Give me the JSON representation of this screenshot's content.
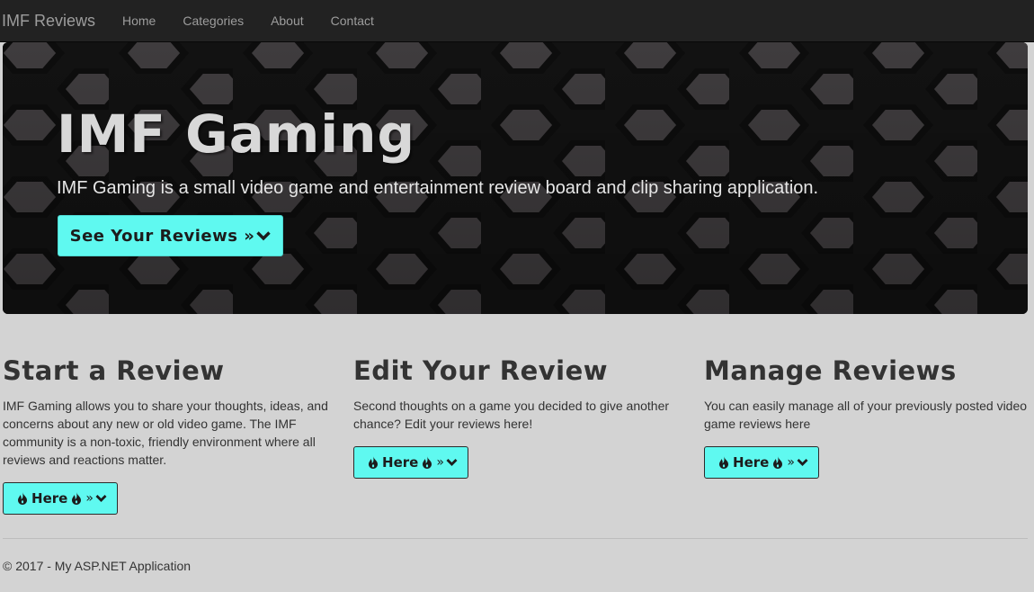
{
  "navbar": {
    "brand": "IMF Reviews",
    "items": [
      "Home",
      "Categories",
      "About",
      "Contact"
    ]
  },
  "hero": {
    "title": "IMF Gaming",
    "lead": "IMF Gaming is a small video game and entertainment review board and clip sharing application.",
    "button_label": "See Your Reviews »"
  },
  "columns": [
    {
      "heading": "Start a Review",
      "text": "IMF Gaming allows you to share your thoughts, ideas, and concerns about any new or old video game. The IMF community is a non-toxic, friendly environment where all reviews and reactions matter.",
      "button_label": "Here",
      "button_suffix": "»"
    },
    {
      "heading": "Edit Your Review",
      "text": "Second thoughts on a game you decided to give another chance? Edit your reviews here!",
      "button_label": "Here",
      "button_suffix": "»"
    },
    {
      "heading": "Manage Reviews",
      "text": "You can easily manage all of your previously posted video game reviews here",
      "button_label": "Here",
      "button_suffix": "»"
    }
  ],
  "footer": {
    "text": "© 2017 - My ASP.NET Application"
  },
  "icons": {
    "hero_button": "chevron-down-icon",
    "small_button": [
      "flame-icon",
      "flame-icon",
      "chevron-down-icon"
    ]
  },
  "colors": {
    "navbar_bg": "#222222",
    "nav_text": "#9d9d9d",
    "accent": "#5ff9f0",
    "page_bg": "#d3d3d3",
    "hero_bg": "#2a2829"
  }
}
